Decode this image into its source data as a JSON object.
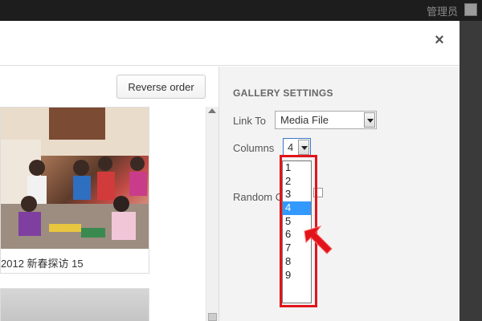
{
  "adminbar": {
    "user_label": "管理员"
  },
  "modal": {
    "close_glyph": "×"
  },
  "toolbar": {
    "reverse_label": "Reverse order"
  },
  "gallery": {
    "items": [
      {
        "caption": "2012 新春探访 15"
      }
    ]
  },
  "settings": {
    "title": "GALLERY SETTINGS",
    "link_to": {
      "label": "Link To",
      "value": "Media File"
    },
    "columns": {
      "label": "Columns",
      "value": "4",
      "options": [
        "1",
        "2",
        "3",
        "4",
        "5",
        "6",
        "7",
        "8",
        "9"
      ],
      "highlighted": "4"
    },
    "random_order": {
      "label": "Random O"
    }
  },
  "colors": {
    "highlight": "#3399ff",
    "annotation": "#e2141b"
  }
}
